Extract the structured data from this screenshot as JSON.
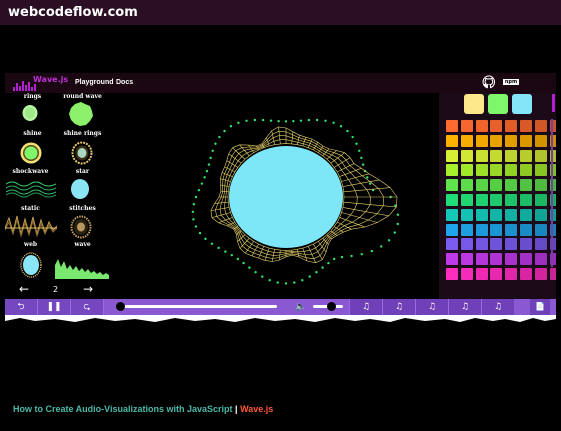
{
  "site": {
    "brand": "webcodeflow.com"
  },
  "app": {
    "logo": "Wave.js",
    "nav": {
      "playground": "Playground",
      "docs": "Docs"
    },
    "npm_label": "npm"
  },
  "visualizations": [
    {
      "label": "rings"
    },
    {
      "label": "round wave"
    },
    {
      "label": "shine"
    },
    {
      "label": "shine rings"
    },
    {
      "label": "shockwave"
    },
    {
      "label": "star"
    },
    {
      "label": "static"
    },
    {
      "label": "stitches"
    },
    {
      "label": "web"
    },
    {
      "label": "wave"
    }
  ],
  "pager": {
    "prev": "←",
    "page": "2",
    "next": "→"
  },
  "palette": {
    "selected": [
      "#fde98b",
      "#7ef86a",
      "#85e5f8"
    ],
    "columns": 8,
    "rows": [
      "#ff6a2e",
      "#ffb300",
      "#d7f035",
      "#a6ef2a",
      "#5fe44c",
      "#22dd77",
      "#14c8b8",
      "#1ea4e8",
      "#7a5cf0",
      "#c039e8",
      "#ff2cc0"
    ]
  },
  "controls": {
    "back": "⮌",
    "pause": "❚❚",
    "forward": "⮎",
    "seek_fraction": 0.02,
    "volume_icon": "🔈",
    "volume_fraction": 0.6,
    "music_icon": "♫",
    "file_icon": "📄"
  },
  "visual": {
    "fill": "#7ee7f7",
    "mesh": "#e8d36a",
    "dots": "#2ee66b"
  },
  "footer": {
    "title": "How to Create Audio-Visualizations with JavaScript",
    "sep": " | ",
    "lib": "Wave.js"
  }
}
